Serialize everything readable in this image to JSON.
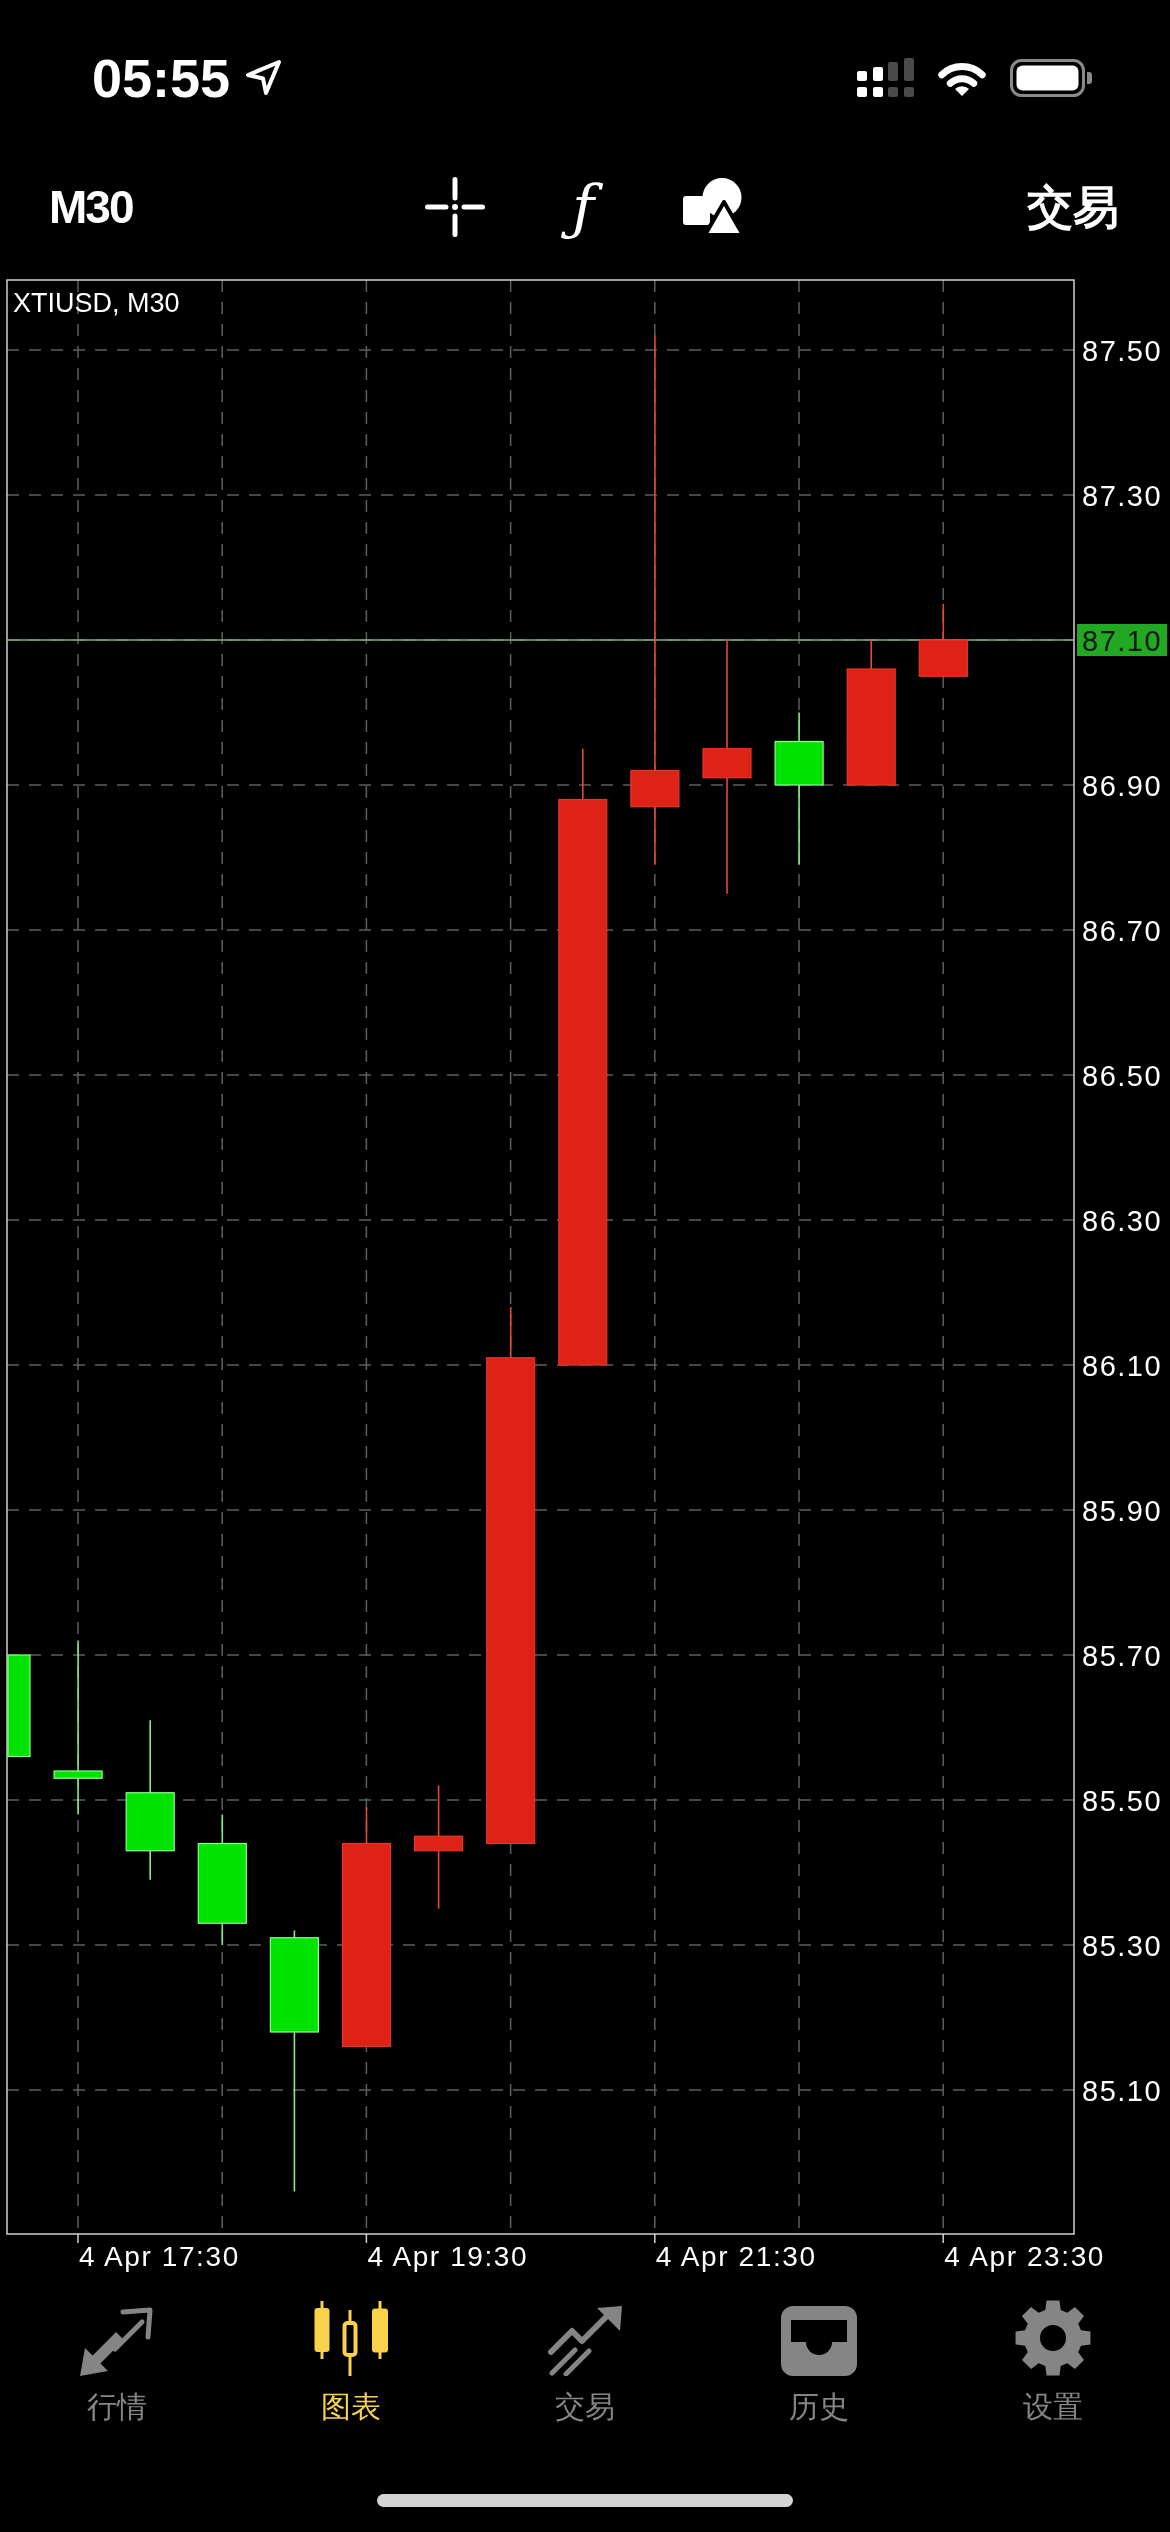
{
  "status_bar": {
    "time": "05:55"
  },
  "toolbar": {
    "timeframe": "M30",
    "function_glyph": "ƒ",
    "trade_button": "交易"
  },
  "chart": {
    "title": "XTIUSD, M30",
    "price_axis": [
      {
        "label": "87.50",
        "kind": "tick"
      },
      {
        "label": "87.30",
        "kind": "tick"
      },
      {
        "label": "87.10",
        "kind": "current"
      },
      {
        "label": "86.90",
        "kind": "tick"
      },
      {
        "label": "86.70",
        "kind": "tick"
      },
      {
        "label": "86.50",
        "kind": "tick"
      },
      {
        "label": "86.30",
        "kind": "tick"
      },
      {
        "label": "86.10",
        "kind": "tick"
      },
      {
        "label": "85.90",
        "kind": "tick"
      },
      {
        "label": "85.70",
        "kind": "tick"
      },
      {
        "label": "85.50",
        "kind": "tick"
      },
      {
        "label": "85.30",
        "kind": "tick"
      },
      {
        "label": "85.10",
        "kind": "tick"
      }
    ],
    "time_axis": [
      "4 Apr 17:30",
      "4 Apr 19:30",
      "4 Apr 21:30",
      "4 Apr 23:30"
    ]
  },
  "tab_bar": {
    "tabs": [
      {
        "label": "行情",
        "selected": false
      },
      {
        "label": "图表",
        "selected": true
      },
      {
        "label": "交易",
        "selected": false
      },
      {
        "label": "历史",
        "selected": false
      },
      {
        "label": "设置",
        "selected": false
      }
    ]
  }
}
